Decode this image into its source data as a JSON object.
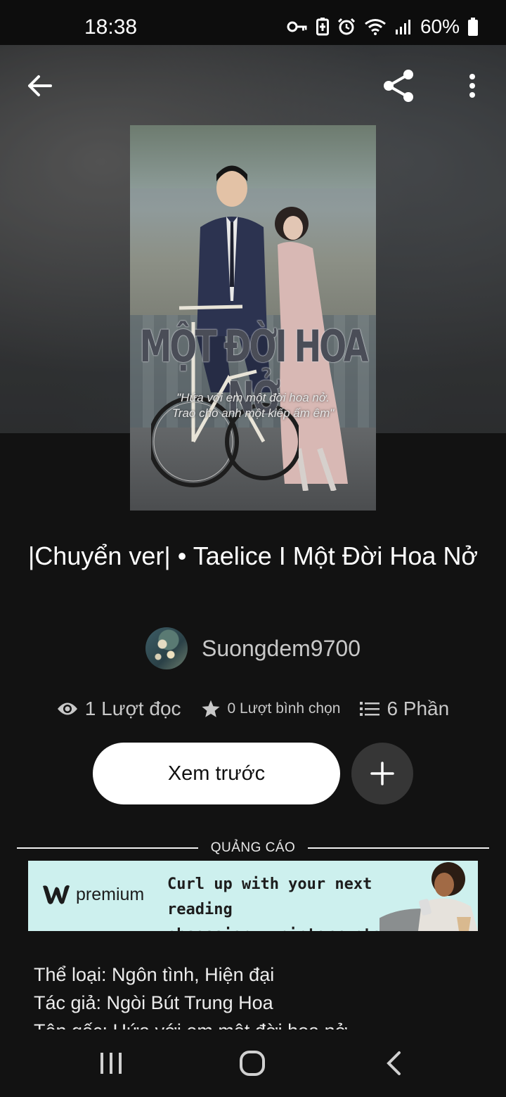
{
  "status_bar": {
    "time": "18:38",
    "battery": "60%"
  },
  "toolbar": {
    "back_icon": "arrow-left-icon",
    "share_icon": "share-icon",
    "more_icon": "more-vertical-icon"
  },
  "cover": {
    "title": "MỘT ĐỜI HOA NỞ",
    "quote_line1": "\"Hứa với em một đời hoa nở.",
    "quote_line2": "Trao cho anh một kiếp ấm êm\""
  },
  "book": {
    "title": "|Chuyển ver| • Taelice I Một Đời Hoa Nở",
    "author": "Suongdem9700"
  },
  "stats": {
    "reads": "1 Lượt đọc",
    "votes": "0 Lượt bình chọn",
    "parts": "6 Phần"
  },
  "actions": {
    "preview_label": "Xem trước",
    "add_icon": "plus-icon"
  },
  "ad": {
    "label": "QUẢNG CÁO",
    "brand": "premium",
    "line1": "Curl up with your next reading",
    "line2": "obsession, uninterrupted.",
    "background": "#cdf0ee"
  },
  "description": {
    "line1": "Thể loại: Ngôn tình, Hiện đại",
    "line2": "Tác giả: Ngòi Bút Trung Hoa",
    "line3": "Tên gốc: Hứa với em một đời hoa nở"
  },
  "colors": {
    "background": "#121212",
    "button_primary": "#ffffff",
    "button_secondary": "#363636",
    "muted_text": "#c8c8c8"
  }
}
